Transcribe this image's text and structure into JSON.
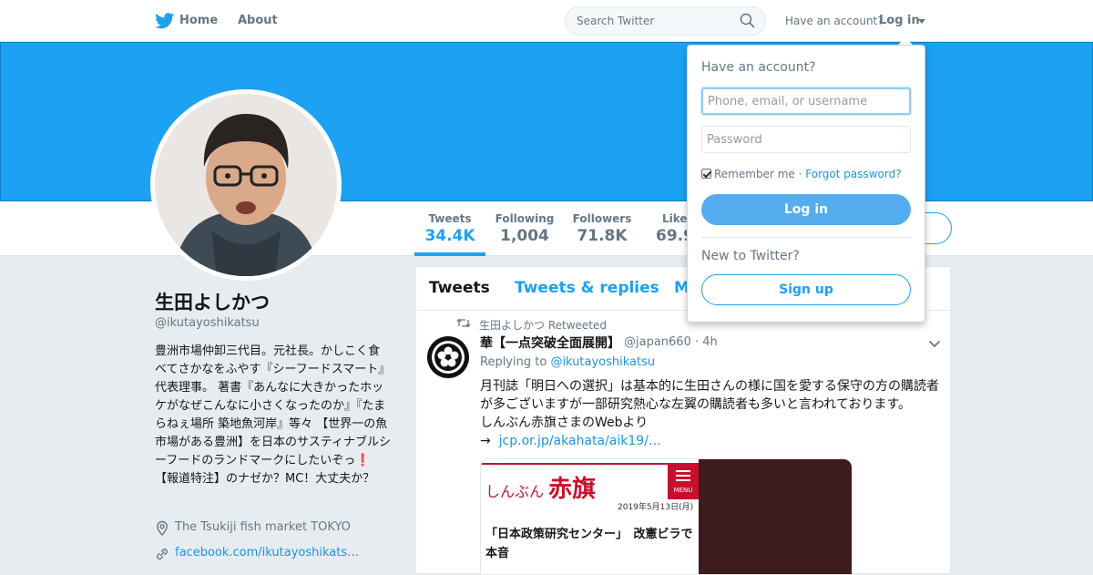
{
  "topbar": {
    "home_label": "Home",
    "about_label": "About",
    "search_placeholder": "Search Twitter",
    "have_account": "Have an account?",
    "login_label": "Log in"
  },
  "profile": {
    "name": "生田よしかつ",
    "handle": "@ikutayoshikatsu",
    "bio": "豊洲市場仲卸三代目。元社長。かしこく食べてさかなをふやす『シーフードスマート』代表理事。 著書『あんなに大きかったホッケがなぜこんなに小さくなったのか』『たまらねぇ場所 築地魚河岸』等々 【世界一の魚市場がある豊洲】を日本のサスティナブルシーフードのランドマークにしたいぞっ❗️ 【報道特注】のナゼか？MC！大丈夫か？",
    "location": "The Tsukiji fish market TOKYO",
    "link": "facebook.com/ikutayoshikats…"
  },
  "stats": [
    {
      "label": "Tweets",
      "value": "34.4K"
    },
    {
      "label": "Following",
      "value": "1,004"
    },
    {
      "label": "Followers",
      "value": "71.8K"
    },
    {
      "label": "Likes",
      "value": "69.9"
    }
  ],
  "timeline": {
    "tabs": [
      "Tweets",
      "Tweets & replies",
      "M"
    ],
    "retweeted_by": "生田よしかつ Retweeted",
    "tweet": {
      "author": "華【一点突破全面展開】",
      "handle": "@japan660",
      "time": "· 4h",
      "replying_prefix": "Replying to",
      "replying_to": "@ikutayoshikatsu",
      "body": "月刊誌「明日への選択」は基本的に生田さんの様に国を愛する保守の方の購読者が多ございますが一部研究熱心な左翼の購読者も多いと言われております。",
      "body2": "しんぶん赤旗さまのWebより",
      "arrow": "→",
      "url": "jcp.or.jp/akahata/aik19/…",
      "card": {
        "logo_small": "しんぶん",
        "logo_big": "赤旗",
        "menu": "MENU",
        "date": "2019年5月13日(月)",
        "headline": "「日本政策研究センター」　改憲ビラで本音"
      }
    }
  },
  "login_dropdown": {
    "title": "Have an account?",
    "user_placeholder": "Phone, email, or username",
    "password_placeholder": "Password",
    "remember": "Remember me",
    "separator": "·",
    "forgot": "Forgot password?",
    "login_button": "Log in",
    "new_to": "New to Twitter?",
    "signup_button": "Sign up"
  },
  "colors": {
    "brand": "#1da1f2",
    "login_button": "#55acee",
    "text_secondary": "#657786"
  },
  "icons": [
    "twitter-bird-icon",
    "search-icon",
    "caret-down-icon",
    "location-pin-icon",
    "link-icon",
    "retweet-icon",
    "chevron-down-icon"
  ]
}
